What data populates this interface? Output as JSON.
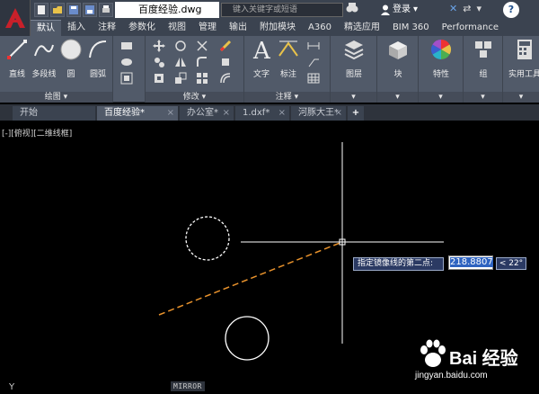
{
  "titlebar": {
    "filename": "百度经验.dwg",
    "search_placeholder": "键入关键字或短语",
    "login_label": "登录",
    "help_label": "?"
  },
  "ribbon_tabs": [
    "默认",
    "插入",
    "注释",
    "参数化",
    "视图",
    "管理",
    "输出",
    "附加模块",
    "A360",
    "精选应用",
    "BIM 360",
    "Performance"
  ],
  "ribbon_active_tab": "默认",
  "panels": {
    "draw": {
      "title": "绘图",
      "tools": [
        "直线",
        "多段线",
        "圆",
        "圆弧"
      ]
    },
    "modify": {
      "title": "修改"
    },
    "annotation": {
      "title": "注释",
      "tools": [
        "文字",
        "标注"
      ]
    },
    "layer": {
      "label": "图层"
    },
    "block": {
      "label": "块"
    },
    "properties": {
      "label": "特性"
    },
    "group": {
      "label": "组"
    },
    "utilities": {
      "label": "实用工具"
    }
  },
  "doc_tabs": [
    {
      "label": "开始",
      "closable": false
    },
    {
      "label": "百度经验*",
      "closable": true,
      "active": true
    },
    {
      "label": "办公室*",
      "closable": true
    },
    {
      "label": "1.dxf*",
      "closable": true
    },
    {
      "label": "河豚大王*",
      "closable": true
    }
  ],
  "viewport_label": "[-][俯视][二维线框]",
  "dynamic_input": {
    "prompt": "指定镜像线的第二点:",
    "value": "218.8807",
    "angle": "< 22°"
  },
  "command_line": "MIRROR",
  "ucs_label": "Y",
  "watermark": {
    "text": "Bai 经验",
    "sub": "jingyan.baidu.com"
  },
  "colors": {
    "ribbon_bg": "#515a69",
    "titlebar_bg": "#3b4350",
    "canvas_bg": "#000000",
    "mirror_line": "#e8922c",
    "app_logo_red": "#c8202a"
  }
}
